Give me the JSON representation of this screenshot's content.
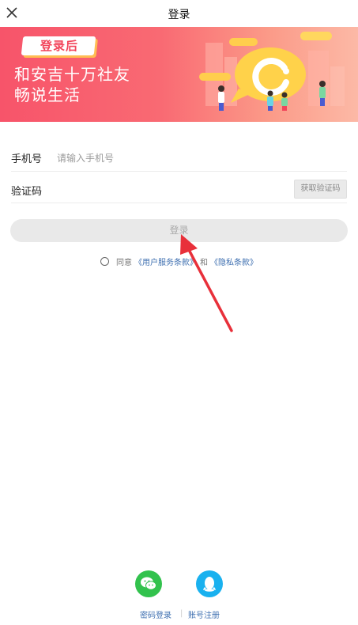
{
  "header": {
    "title": "登录",
    "close_icon": "close-icon"
  },
  "banner": {
    "badge": "登录后",
    "line1": "和安吉十万社友",
    "line2": "畅说生活",
    "colors": {
      "start": "#f7546a",
      "end": "#fcb9a6",
      "bubble": "#ffd24a"
    }
  },
  "form": {
    "phone_label": "手机号",
    "phone_placeholder": "请输入手机号",
    "phone_value": "",
    "code_label": "验证码",
    "code_value": "",
    "get_code_label": "获取验证码"
  },
  "login_button": "登录",
  "agreement": {
    "prefix": "同意",
    "terms": "《用户服务条款》",
    "and": "和",
    "privacy": "《隐私条款》"
  },
  "bottom": {
    "wechat_icon": "wechat-icon",
    "qq_icon": "qq-icon",
    "password_login": "密码登录",
    "separator": "|",
    "register": "账号注册"
  },
  "accent_colors": {
    "link": "#3e6fb0",
    "wechat": "#32c24d",
    "qq": "#19b1ef",
    "arrow": "#e8303a"
  }
}
